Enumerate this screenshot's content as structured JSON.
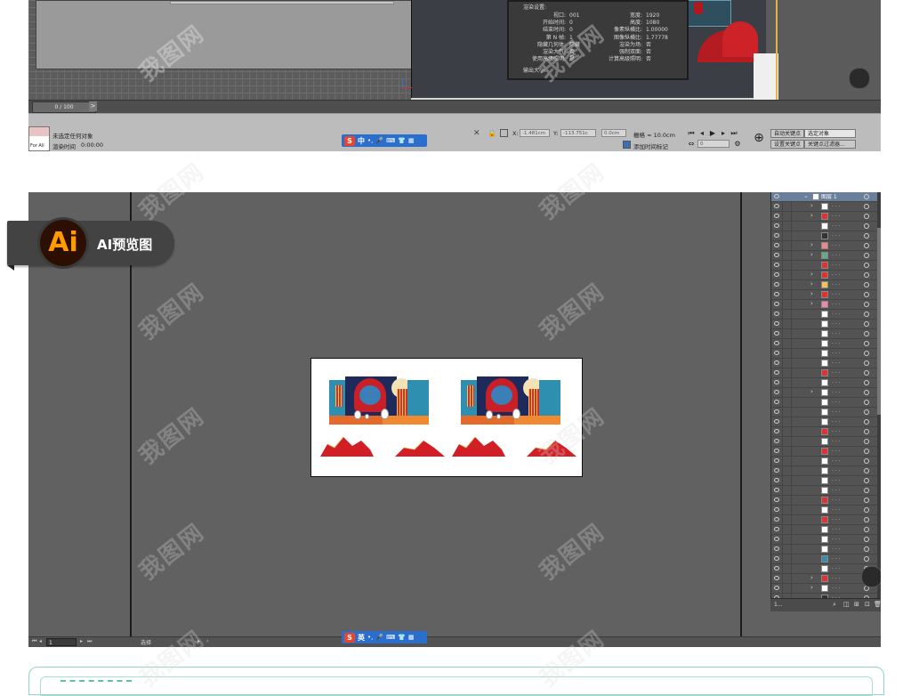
{
  "max_window": {
    "render_dialog": {
      "title": "渲染设置:",
      "left_rows": [
        {
          "label": "视口",
          "value": "001"
        },
        {
          "label": "开始时间",
          "value": "0"
        },
        {
          "label": "结束时间",
          "value": "0"
        },
        {
          "label": "第 N 帧",
          "value": "1"
        },
        {
          "label": "隐藏几何体",
          "value": "隐藏"
        },
        {
          "label": "渲染大气",
          "value": "否"
        },
        {
          "label": "使用高级照明",
          "value": "是"
        }
      ],
      "right_rows": [
        {
          "label": "宽度",
          "value": "1920"
        },
        {
          "label": "高度",
          "value": "1080"
        },
        {
          "label": "像素纵横比",
          "value": "1.00000"
        },
        {
          "label": "图像纵横比",
          "value": "1.77778"
        },
        {
          "label": "渲染为场",
          "value": "否"
        },
        {
          "label": "强制双面",
          "value": "否"
        },
        {
          "label": "计算高级照明",
          "value": "否"
        }
      ],
      "footer": "输出大小:"
    },
    "timeline": {
      "frame_counter": "0 / 100",
      "next_arrow": ">"
    },
    "status": {
      "script_label": "For All",
      "selection_text": "未选定任何对象",
      "render_time_label": "渲染时间",
      "render_time_value": "0:00:00",
      "x_label": "X:",
      "x_value": "-1.481cm",
      "y_label": "Y:",
      "y_value": "-113.751c",
      "z_value": "0.0cm",
      "grid_text": "栅格 = 10.0cm",
      "add_time_tag": "添加时间标记",
      "auto_key": "自动关键点",
      "selected_object": "选定对象",
      "set_key": "设置关键点",
      "key_filters": "关键点过滤器...",
      "frame_field": "0"
    },
    "ime": {
      "lang": "中"
    }
  },
  "ai_window": {
    "badge": {
      "logo": "Ai",
      "label": "AI预览图"
    },
    "layers": {
      "top_layer_name": "图层 1",
      "footer_text": "1..."
    },
    "bottombar": {
      "page": "1",
      "tool_name": "选择"
    },
    "ime": {
      "lang": "英"
    }
  },
  "watermark_text": "我图网",
  "colors": {
    "ai_orange": "#ff9a00",
    "ai_dark": "#2d0f01",
    "ime_blue": "#2a6fce",
    "design_red": "#c82026",
    "design_blue": "#2f8fb0"
  }
}
